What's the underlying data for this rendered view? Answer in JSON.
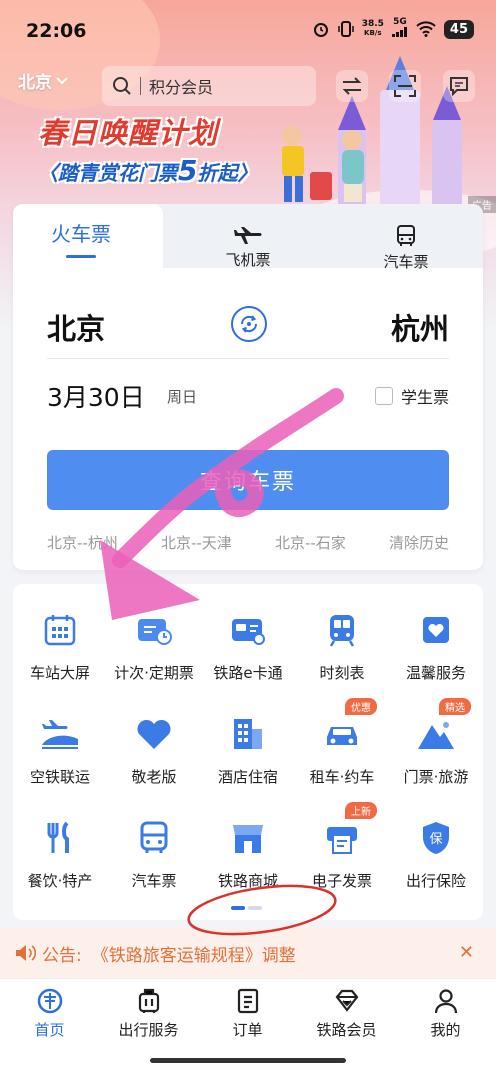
{
  "status": {
    "time": "22:06",
    "net_speed": "38.5",
    "net_unit": "KB/s",
    "signal": "5G",
    "battery": "45"
  },
  "header": {
    "city": "北京",
    "search_placeholder": "积分会员"
  },
  "promo": {
    "title": "春日唤醒计划",
    "sub_prefix": "〈踏青赏花门票",
    "sub_big": "5",
    "sub_suffix": "折起〉",
    "ad_tag": "广告"
  },
  "tabs": {
    "train": "火车票",
    "plane": "飞机票",
    "bus": "汽车票"
  },
  "booking": {
    "from": "北京",
    "to": "杭州",
    "date": "3月30日",
    "weekday": "周日",
    "student_label": "学生票",
    "query_label": "查询车票",
    "history": [
      "北京--杭州",
      "北京--天津",
      "北京--石家",
      "清除历史"
    ]
  },
  "services": [
    {
      "label": "车站大屏",
      "icon": "calendar-grid-icon"
    },
    {
      "label": "计次·定期票",
      "icon": "ticket-clock-icon"
    },
    {
      "label": "铁路e卡通",
      "icon": "rail-card-icon"
    },
    {
      "label": "时刻表",
      "icon": "train-front-icon"
    },
    {
      "label": "温馨服务",
      "icon": "heart-box-icon"
    },
    {
      "label": "空铁联运",
      "icon": "plane-train-icon"
    },
    {
      "label": "敬老版",
      "icon": "heart-icon"
    },
    {
      "label": "酒店住宿",
      "icon": "hotel-building-icon"
    },
    {
      "label": "租车·约车",
      "icon": "car-icon",
      "badge": "优惠"
    },
    {
      "label": "门票·旅游",
      "icon": "mountain-icon",
      "badge": "精选"
    },
    {
      "label": "餐饮·特产",
      "icon": "fork-knife-icon"
    },
    {
      "label": "汽车票",
      "icon": "bus-icon"
    },
    {
      "label": "铁路商城",
      "icon": "store-icon"
    },
    {
      "label": "电子发票",
      "icon": "invoice-printer-icon",
      "badge": "上新"
    },
    {
      "label": "出行保险",
      "icon": "shield-icon"
    }
  ],
  "notice": {
    "label": "公告:",
    "text": "《铁路旅客运输规程》调整"
  },
  "nav": {
    "home": "首页",
    "travel": "出行服务",
    "orders": "订单",
    "member": "铁路会员",
    "me": "我的"
  },
  "colors": {
    "accent": "#2d6fe0",
    "button": "#4f8ef0",
    "notice": "#e2703a",
    "annotation_pink": "#ea5fb8",
    "annotation_red": "#d8332c"
  }
}
